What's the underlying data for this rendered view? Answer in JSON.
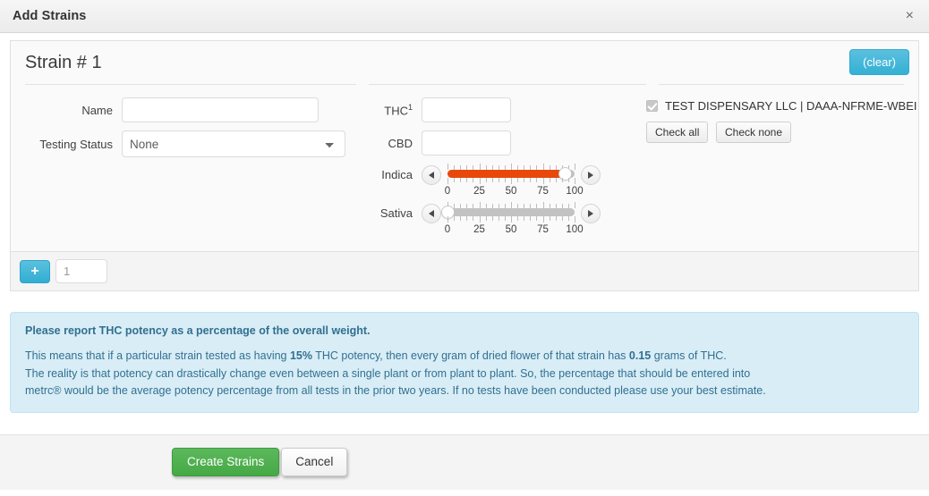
{
  "header": {
    "title": "Add Strains",
    "close_label": "×"
  },
  "strain": {
    "panel_title": "Strain # 1",
    "clear_label": "(clear)",
    "fields": {
      "name_label": "Name",
      "name_value": "",
      "testing_status_label": "Testing Status",
      "testing_status_value": "None",
      "testing_status_options": [
        "None"
      ],
      "thc_label": "THC",
      "thc_footnote": "1",
      "thc_value": "",
      "cbd_label": "CBD",
      "cbd_value": ""
    },
    "sliders": [
      {
        "label": "Indica",
        "value": 92,
        "min": 0,
        "max": 100,
        "filled": true,
        "ticks": [
          "0",
          "25",
          "50",
          "75",
          "100"
        ]
      },
      {
        "label": "Sativa",
        "value": 0,
        "min": 0,
        "max": 100,
        "filled": false,
        "ticks": [
          "0",
          "25",
          "50",
          "75",
          "100"
        ]
      }
    ],
    "dispensary": {
      "checked": true,
      "label": "TEST DISPENSARY LLC | DAAA-NFRME-WBEI",
      "check_all_label": "Check all",
      "check_none_label": "Check none"
    }
  },
  "add_row": {
    "plus_label": "+",
    "quantity_value": "1"
  },
  "alert": {
    "title": "Please report THC potency as a percentage of the overall weight.",
    "line1_a": "This means that if a particular strain tested as having ",
    "line1_b": "15%",
    "line1_c": " THC potency, then every gram of dried flower of that strain has ",
    "line1_d": "0.15",
    "line1_e": " grams of THC.",
    "line2": "The reality is that potency can drastically change even between a single plant or from plant to plant. So, the percentage that should be entered into",
    "line3": "metrc® would be the average potency percentage from all tests in the prior two years. If no tests have been conducted please use your best estimate."
  },
  "footer": {
    "submit_label": "Create Strains",
    "cancel_label": "Cancel"
  },
  "colors": {
    "accent_blue": "#5bc0de",
    "slider_fill": "#e8490b",
    "primary_green": "#5cb85c",
    "alert_bg": "#d9edf7",
    "alert_text": "#31708f"
  }
}
